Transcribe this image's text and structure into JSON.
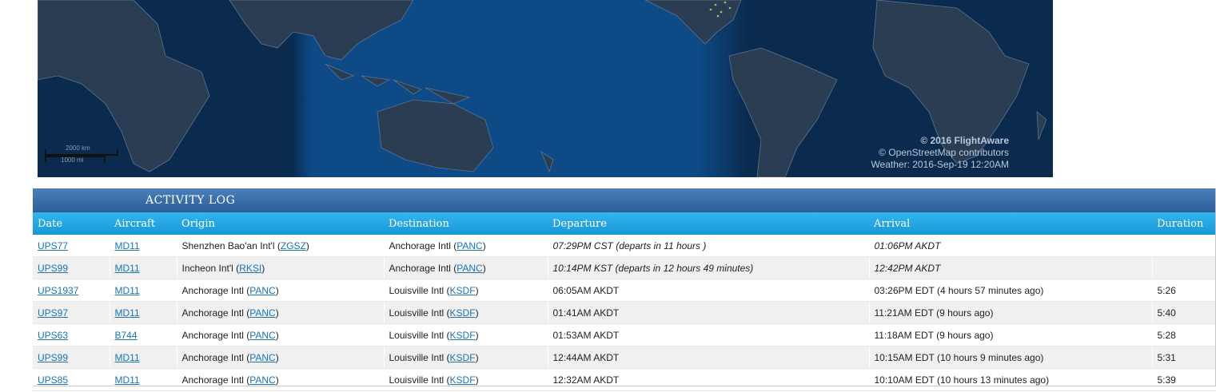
{
  "map": {
    "credits": [
      "© 2016 FlightAware",
      "© OpenStreetMap contributors",
      "Weather: 2016-Sep-19 12:20AM"
    ],
    "scale_km": "2000 km",
    "scale_mi": "1000 mi"
  },
  "activity_log": {
    "title": "ACTIVITY LOG",
    "columns": [
      "Date",
      "Aircraft",
      "Origin",
      "Destination",
      "Departure",
      "Arrival",
      "Duration"
    ],
    "rows": [
      {
        "flight": "UPS77",
        "aircraft": "MD11",
        "origin": "Shenzhen Bao'an Int'l",
        "origin_code": "ZGSZ",
        "dest": "Anchorage Intl",
        "dest_code": "PANC",
        "departure": "07:29PM CST (departs in 11 hours )",
        "arrival": "01:06PM AKDT",
        "duration": "",
        "italic": true
      },
      {
        "flight": "UPS99",
        "aircraft": "MD11",
        "origin": "Incheon Int'l",
        "origin_code": "RKSI",
        "dest": "Anchorage Intl",
        "dest_code": "PANC",
        "departure": "10:14PM KST (departs in 12 hours 49 minutes)",
        "arrival": "12:42PM AKDT",
        "duration": "",
        "italic": true
      },
      {
        "flight": "UPS1937",
        "aircraft": "MD11",
        "origin": "Anchorage Intl",
        "origin_code": "PANC",
        "dest": "Louisville Intl",
        "dest_code": "KSDF",
        "departure": "06:05AM AKDT",
        "arrival": "03:26PM EDT (4 hours 57 minutes ago)",
        "duration": "5:26",
        "italic": false
      },
      {
        "flight": "UPS97",
        "aircraft": "MD11",
        "origin": "Anchorage Intl",
        "origin_code": "PANC",
        "dest": "Louisville Intl",
        "dest_code": "KSDF",
        "departure": "01:41AM AKDT",
        "arrival": "11:21AM EDT (9 hours ago)",
        "duration": "5:40",
        "italic": false
      },
      {
        "flight": "UPS63",
        "aircraft": "B744",
        "origin": "Anchorage Intl",
        "origin_code": "PANC",
        "dest": "Louisville Intl",
        "dest_code": "KSDF",
        "departure": "01:53AM AKDT",
        "arrival": "11:18AM EDT (9 hours ago)",
        "duration": "5:28",
        "italic": false
      },
      {
        "flight": "UPS99",
        "aircraft": "MD11",
        "origin": "Anchorage Intl",
        "origin_code": "PANC",
        "dest": "Louisville Intl",
        "dest_code": "KSDF",
        "departure": "12:44AM AKDT",
        "arrival": "10:15AM EDT (10 hours 9 minutes ago)",
        "duration": "5:31",
        "italic": false
      },
      {
        "flight": "UPS85",
        "aircraft": "MD11",
        "origin": "Anchorage Intl",
        "origin_code": "PANC",
        "dest": "Louisville Intl",
        "dest_code": "KSDF",
        "departure": "12:32AM AKDT",
        "arrival": "10:10AM EDT (10 hours 13 minutes ago)",
        "duration": "5:39",
        "italic": false
      }
    ]
  },
  "colors": {
    "ocean": "#0b3a6b",
    "land": "#2a3d52",
    "header_dark": "#2c5f99",
    "header_light": "#1699d8",
    "link": "#1a74b8"
  }
}
